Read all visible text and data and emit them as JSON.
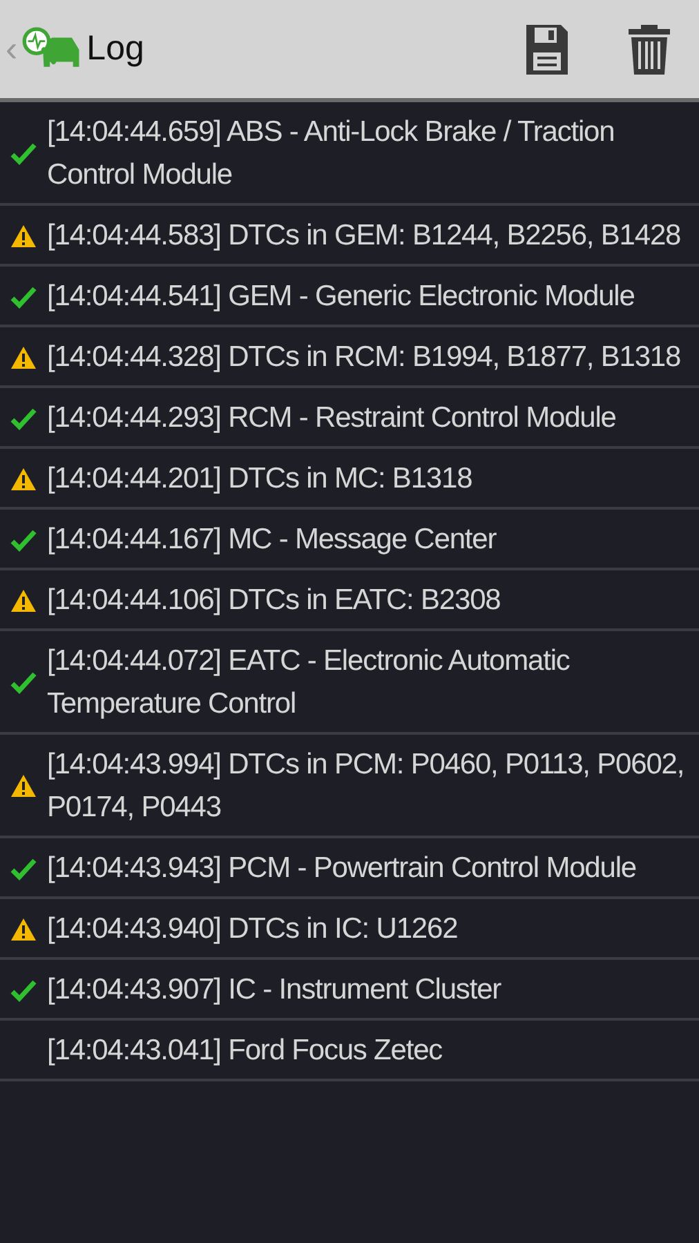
{
  "header": {
    "back": "‹",
    "title": "Log"
  },
  "entries": [
    {
      "kind": "ok",
      "text": "[14:04:44.659] ABS - Anti-Lock Brake / Traction Control Module"
    },
    {
      "kind": "warning",
      "text": "[14:04:44.583] DTCs in GEM: B1244, B2256, B1428"
    },
    {
      "kind": "ok",
      "text": "[14:04:44.541] GEM - Generic Electronic Module"
    },
    {
      "kind": "warning",
      "text": "[14:04:44.328] DTCs in RCM: B1994, B1877, B1318"
    },
    {
      "kind": "ok",
      "text": "[14:04:44.293] RCM - Restraint Control Module"
    },
    {
      "kind": "warning",
      "text": "[14:04:44.201] DTCs in MC: B1318"
    },
    {
      "kind": "ok",
      "text": "[14:04:44.167] MC - Message Center"
    },
    {
      "kind": "warning",
      "text": "[14:04:44.106] DTCs in EATC: B2308"
    },
    {
      "kind": "ok",
      "text": "[14:04:44.072] EATC - Electronic Automatic Temperature Control"
    },
    {
      "kind": "warning",
      "text": "[14:04:43.994] DTCs in PCM: P0460, P0113, P0602, P0174, P0443"
    },
    {
      "kind": "ok",
      "text": "[14:04:43.943] PCM - Powertrain Control Module"
    },
    {
      "kind": "warning",
      "text": "[14:04:43.940] DTCs in IC: U1262"
    },
    {
      "kind": "ok",
      "text": "[14:04:43.907] IC - Instrument Cluster"
    },
    {
      "kind": "none",
      "text": "[14:04:43.041] Ford Focus Zetec"
    }
  ]
}
